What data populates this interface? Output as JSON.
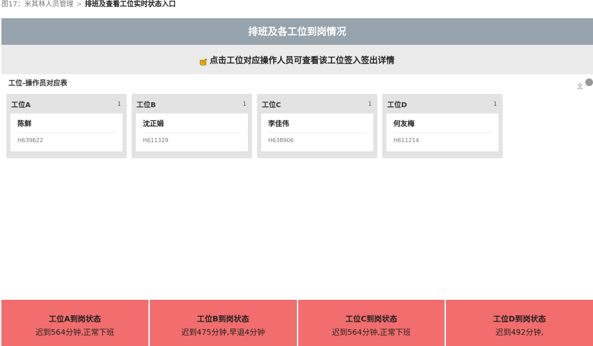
{
  "breadcrumb": {
    "prefix": "图17：",
    "parent": "米其林人员管理",
    "separator": ">",
    "current": "排班及查看工位实时状态入口"
  },
  "header": {
    "title": "排班及各工位到岗情况"
  },
  "hint": {
    "icon": "hand-pointer-icon",
    "text": "点击工位对应操作人员可查看该工位签入签出详情"
  },
  "section": {
    "title": "工位-操作员对应表"
  },
  "stations": [
    {
      "name": "工位A",
      "count": "1",
      "staff_name": "陈鲜",
      "staff_id": "H639622"
    },
    {
      "name": "工位B",
      "count": "1",
      "staff_name": "沈正娟",
      "staff_id": "H611329"
    },
    {
      "name": "工位C",
      "count": "1",
      "staff_name": "李佳伟",
      "staff_id": "H638906"
    },
    {
      "name": "工位D",
      "count": "1",
      "staff_name": "何友梅",
      "staff_id": "H611214"
    }
  ],
  "status_cards": [
    {
      "title": "工位A到岗状态",
      "detail": "迟到564分钟,正常下班"
    },
    {
      "title": "工位B到岗状态",
      "detail": "迟到475分钟,早退4分钟"
    },
    {
      "title": "工位C到岗状态",
      "detail": "迟到564分钟,正常下班"
    },
    {
      "title": "工位D到岗状态",
      "detail": "迟到492分钟,"
    }
  ],
  "colors": {
    "header": "#98a4ad",
    "hint_bg": "#ebebeb",
    "station_bg": "#e3e3e3",
    "status_red": "#f26d6d"
  }
}
